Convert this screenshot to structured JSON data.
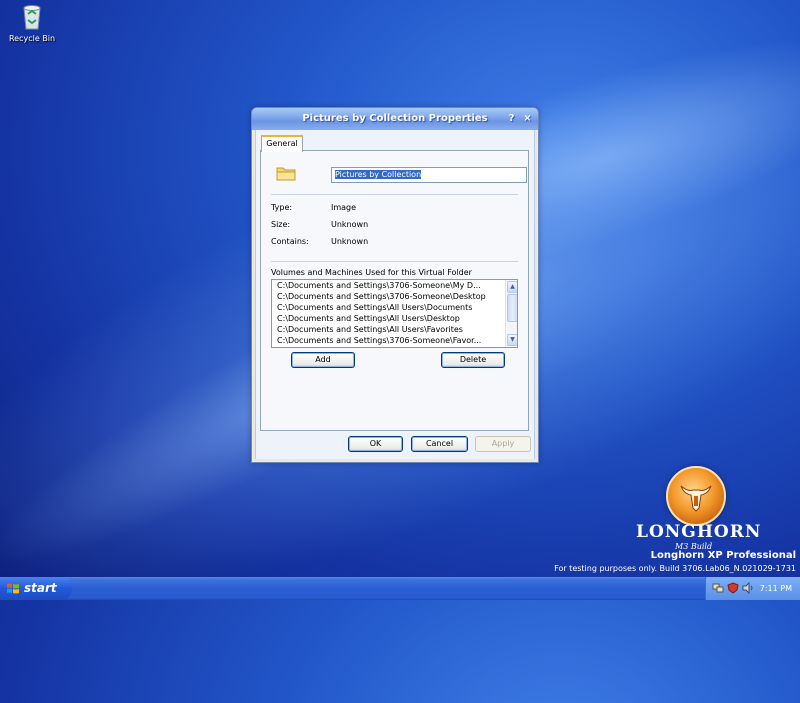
{
  "desktop": {
    "icons": [
      {
        "label": "Recycle Bin",
        "icon": "recycle-bin-icon"
      }
    ]
  },
  "dialog": {
    "title": "Pictures by Collection Properties",
    "help_button": "?",
    "close_button": "×",
    "tabs": [
      {
        "label": "General"
      }
    ],
    "name_value": "Pictures by Collection",
    "properties": [
      {
        "label": "Type:",
        "value": "Image"
      },
      {
        "label": "Size:",
        "value": "Unknown"
      },
      {
        "label": "Contains:",
        "value": "Unknown"
      }
    ],
    "volumes_label": "Volumes and Machines Used for this Virtual Folder",
    "volumes": [
      "C:\\Documents and Settings\\3706-Someone\\My D...",
      "C:\\Documents and Settings\\3706-Someone\\Desktop",
      "C:\\Documents and Settings\\All Users\\Documents",
      "C:\\Documents and Settings\\All Users\\Desktop",
      "C:\\Documents and Settings\\All Users\\Favorites",
      "C:\\Documents and Settings\\3706-Someone\\Favor..."
    ],
    "add_label": "Add",
    "delete_label": "Delete",
    "ok_label": "OK",
    "cancel_label": "Cancel",
    "apply_label": "Apply"
  },
  "branding": {
    "title": "LONGHORN",
    "subtitle": "M3 Build",
    "edition": "Longhorn XP Professional",
    "build": "For testing purposes only. Build 3706.Lab06_N.021029-1731"
  },
  "taskbar": {
    "start_label": "start",
    "clock": "7:11 PM",
    "tray_icons": [
      "network-icon",
      "shield-icon",
      "volume-icon"
    ]
  },
  "colors": {
    "accent": "#316ac5",
    "taskbar": "#2a5ed4",
    "logo": "#f39a2c"
  }
}
